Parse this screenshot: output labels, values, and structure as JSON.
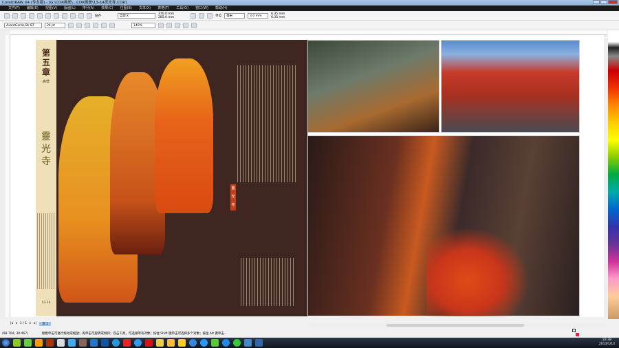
{
  "window": {
    "title": "CorelDRAW X4 (专业版) - [G:\\CDR画册\\...CDR画册\\13-14灵光寺.CDR]"
  },
  "menu": [
    "文件(F)",
    "编辑(E)",
    "视图(V)",
    "版面(L)",
    "排列(A)",
    "效果(C)",
    "位图(B)",
    "文本(X)",
    "表格(T)",
    "工具(O)",
    "窗口(W)",
    "帮助(H)"
  ],
  "toolbar1": {
    "snap_label": "贴齐",
    "paper_preset": "自定义",
    "width": "370.0 mm",
    "height": "285.0 mm",
    "units_label": "单位",
    "units": "毫米",
    "nudge": "3.0 mm",
    "dup_x": "6.35 mm",
    "dup_y": "6.35 mm"
  },
  "toolbar2": {
    "font": "AvantGarde Bk BT",
    "font_size": "24 pt",
    "zoom": "140%"
  },
  "document": {
    "chapter": "第五章",
    "subtitle": "高僧",
    "spirit": "靈光寺",
    "page_number": "13-14",
    "seal": "靈光寺"
  },
  "pagebar": {
    "page_count": "1 / 1",
    "page_tab": "页 1"
  },
  "status": {
    "coords": "(98.704, 30.467)",
    "hint": "接着单击可进行拖动或缩放；再单击可旋转或倾斜；双击工具，可选择所有对象；按住 Shift 键单击可选择多个对象；按住 Alt 键单击..."
  },
  "clock": {
    "time": "22:38",
    "date": "2013/1/13"
  },
  "colors": {
    "accent": "#3f2620",
    "strip": "#eee0b8",
    "robe": "#e8641a",
    "saffron": "#f0a81a"
  }
}
